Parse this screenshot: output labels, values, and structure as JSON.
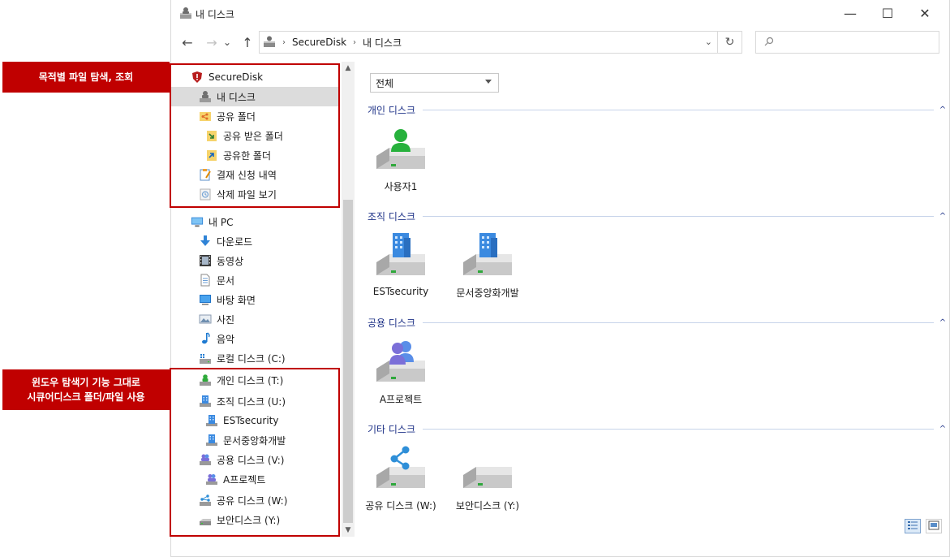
{
  "callouts": {
    "top": "목적별 파일 탐색, 조회",
    "bottom_line1": "윈도우 탐색기 기능 그대로",
    "bottom_line2": "시큐어디스크 폴더/파일 사용"
  },
  "window": {
    "title": "내 디스크",
    "controls": {
      "minimize": "—",
      "maximize": "☐",
      "close": "✕"
    }
  },
  "navbar": {
    "back": "←",
    "forward": "→",
    "recent": "⌄",
    "up": "↑",
    "breadcrumbs": [
      "SecureDisk",
      "내 디스크"
    ],
    "separator": "›",
    "dropdown": "⌄",
    "refresh": "↻",
    "search_icon": "search-icon"
  },
  "sidebar": {
    "items": [
      {
        "label": "SecureDisk",
        "icon": "shield-icon"
      },
      {
        "label": "내 디스크",
        "icon": "user-disk-icon",
        "selected": true
      },
      {
        "label": "공유 폴더",
        "icon": "share-folder-icon"
      },
      {
        "label": "공유 받은 폴더",
        "icon": "received-folder-icon"
      },
      {
        "label": "공유한 폴더",
        "icon": "shared-folder-icon"
      },
      {
        "label": "결재 신청 내역",
        "icon": "approval-icon"
      },
      {
        "label": "삭제 파일 보기",
        "icon": "deleted-files-icon"
      },
      {
        "label": "내 PC",
        "icon": "pc-icon"
      },
      {
        "label": "다운로드",
        "icon": "download-icon"
      },
      {
        "label": "동영상",
        "icon": "video-icon"
      },
      {
        "label": "문서",
        "icon": "document-icon"
      },
      {
        "label": "바탕 화면",
        "icon": "desktop-icon"
      },
      {
        "label": "사진",
        "icon": "picture-icon"
      },
      {
        "label": "음악",
        "icon": "music-icon"
      },
      {
        "label": "로컬 디스크 (C:)",
        "icon": "local-disk-icon"
      },
      {
        "label": "개인 디스크 (T:)",
        "icon": "personal-disk-icon"
      },
      {
        "label": "조직 디스크 (U:)",
        "icon": "org-disk-icon"
      },
      {
        "label": "ESTsecurity",
        "icon": "building-icon"
      },
      {
        "label": "문서중앙화개발",
        "icon": "building-icon"
      },
      {
        "label": "공용 디스크 (V:)",
        "icon": "public-disk-icon"
      },
      {
        "label": "A프로젝트",
        "icon": "group-icon"
      },
      {
        "label": "공유 디스크 (W:)",
        "icon": "share-disk-icon"
      },
      {
        "label": "보안디스크 (Y:)",
        "icon": "secure-disk-icon"
      }
    ]
  },
  "content": {
    "filter_value": "전체",
    "groups": [
      {
        "title": "개인 디스크",
        "collapse": "^",
        "items": [
          {
            "label": "사용자1",
            "icon": "user-drive-icon"
          }
        ]
      },
      {
        "title": "조직 디스크",
        "collapse": "^",
        "items": [
          {
            "label": "ESTsecurity",
            "icon": "building-drive-icon"
          },
          {
            "label": "문서중앙화개발",
            "icon": "building-drive-icon"
          }
        ]
      },
      {
        "title": "공용 디스크",
        "collapse": "^",
        "items": [
          {
            "label": "A프로젝트",
            "icon": "group-drive-icon"
          }
        ]
      },
      {
        "title": "기타 디스크",
        "collapse": "^",
        "items": [
          {
            "label": "공유 디스크 (W:)",
            "icon": "share-drive-icon"
          },
          {
            "label": "보안디스크 (Y:)",
            "icon": "plain-drive-icon"
          }
        ]
      }
    ]
  },
  "scroll": {
    "up": "▲",
    "down": "▼"
  },
  "colors": {
    "accent_red": "#c00000",
    "group_header": "#1e3287",
    "selection": "#dcdcdc"
  }
}
